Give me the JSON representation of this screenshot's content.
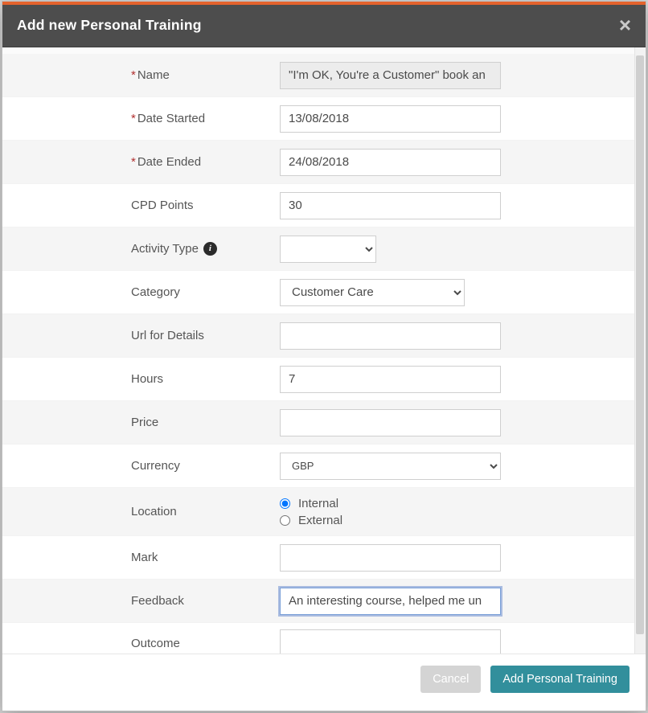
{
  "modal": {
    "title": "Add new Personal Training"
  },
  "labels": {
    "name": "Name",
    "date_started": "Date Started",
    "date_ended": "Date Ended",
    "cpd_points": "CPD Points",
    "activity_type": "Activity Type",
    "category": "Category",
    "url": "Url for Details",
    "hours": "Hours",
    "price": "Price",
    "currency": "Currency",
    "location": "Location",
    "mark": "Mark",
    "feedback": "Feedback",
    "outcome": "Outcome"
  },
  "values": {
    "name": "\"I'm OK, You're a Customer\" book an",
    "date_started": "13/08/2018",
    "date_ended": "24/08/2018",
    "cpd_points": "30",
    "activity_type": "",
    "category": "Customer Care",
    "url": "",
    "hours": "7",
    "price": "",
    "currency": "GBP",
    "mark": "",
    "feedback": "An interesting course, helped me un",
    "outcome": ""
  },
  "location": {
    "option_internal": "Internal",
    "option_external": "External",
    "selected": "internal"
  },
  "buttons": {
    "cancel": "Cancel",
    "submit": "Add Personal Training"
  }
}
